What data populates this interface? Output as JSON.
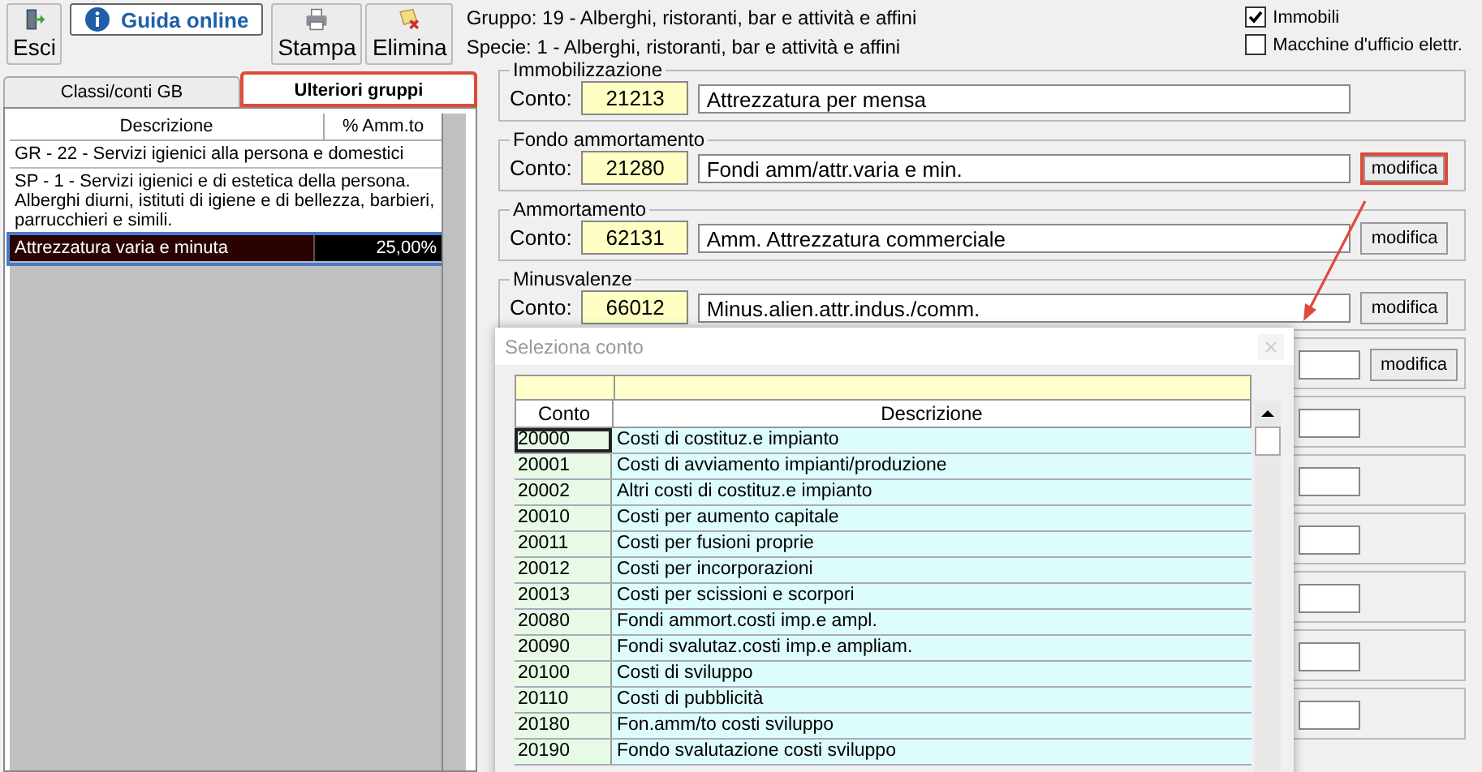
{
  "toolbar": {
    "buttons": [
      {
        "kind": "exit",
        "label": "Esci"
      },
      {
        "kind": "help",
        "label": "Guida online"
      },
      {
        "kind": "print",
        "label": "Stampa"
      },
      {
        "kind": "delete",
        "label": "Elimina"
      }
    ]
  },
  "info": {
    "gruppo": "Gruppo: 19 - Alberghi, ristoranti, bar e attività e affini",
    "specie": "Specie: 1 - Alberghi, ristoranti, bar e attività e affini"
  },
  "options": [
    {
      "label": "Immobili",
      "checked": true
    },
    {
      "label": "Macchine d'ufficio elettr.",
      "checked": false
    }
  ],
  "tabs": [
    {
      "label": "Classi/conti GB",
      "selected": false,
      "highlighted": false
    },
    {
      "label": "Ulteriori gruppi",
      "selected": true,
      "highlighted": true
    }
  ],
  "groups_table": {
    "columns": [
      "Descrizione",
      "% Amm.to"
    ],
    "rows": [
      {
        "descrizione": "GR - 22 - Servizi igienici alla persona e domestici",
        "percent": "",
        "selected": false
      },
      {
        "descrizione": "SP - 1 - Servizi igienici e di estetica della persona. Alberghi diurni, istituti di igiene e di bellezza, barbieri, parrucchieri e simili.",
        "percent": "",
        "selected": false
      },
      {
        "descrizione": "Attrezzatura varia e minuta",
        "percent": "25,00%",
        "selected": true
      }
    ]
  },
  "accounts": [
    {
      "title": "Immobilizzazione",
      "label": "Conto:",
      "code": "21213",
      "description": "Attrezzatura per mensa",
      "highlighted": false
    },
    {
      "title": "Fondo ammortamento",
      "label": "Conto:",
      "code": "21280",
      "description": "Fondi amm/attr.varia e min.",
      "button": "modifica",
      "highlighted": true
    },
    {
      "title": "Ammortamento",
      "label": "Conto:",
      "code": "62131",
      "description": "Amm. Attrezzatura commerciale",
      "button": "modifica",
      "highlighted": false
    },
    {
      "title": "Minusvalenze",
      "label": "Conto:",
      "code": "66012",
      "description": "Minus.alien.attr.indus./comm.",
      "button": "modifica",
      "highlighted": false
    }
  ],
  "hidden_button": "modifica",
  "dialog": {
    "title": "Seleziona conto",
    "columns": [
      "Conto",
      "Descrizione"
    ],
    "rows": [
      {
        "conto": "20000",
        "descrizione": "Costi di costituz.e impianto",
        "selected": true
      },
      {
        "conto": "20001",
        "descrizione": "Costi di avviamento impianti/produzione",
        "selected": false
      },
      {
        "conto": "20002",
        "descrizione": "Altri costi di costituz.e impianto",
        "selected": false
      },
      {
        "conto": "20010",
        "descrizione": "Costi per aumento capitale",
        "selected": false
      },
      {
        "conto": "20011",
        "descrizione": "Costi per fusioni proprie",
        "selected": false
      },
      {
        "conto": "20012",
        "descrizione": "Costi per incorporazioni",
        "selected": false
      },
      {
        "conto": "20013",
        "descrizione": "Costi per scissioni e scorpori",
        "selected": false
      },
      {
        "conto": "20080",
        "descrizione": "Fondi ammort.costi imp.e ampl.",
        "selected": false
      },
      {
        "conto": "20090",
        "descrizione": "Fondi svalutaz.costi imp.e ampliam.",
        "selected": false
      },
      {
        "conto": "20100",
        "descrizione": "Costi di sviluppo",
        "selected": false
      },
      {
        "conto": "20110",
        "descrizione": "Costi di pubblicità",
        "selected": false
      },
      {
        "conto": "20180",
        "descrizione": "Fon.amm/to costi sviluppo",
        "selected": false
      },
      {
        "conto": "20190",
        "descrizione": "Fondo svalutazione costi sviluppo",
        "selected": false
      }
    ]
  }
}
